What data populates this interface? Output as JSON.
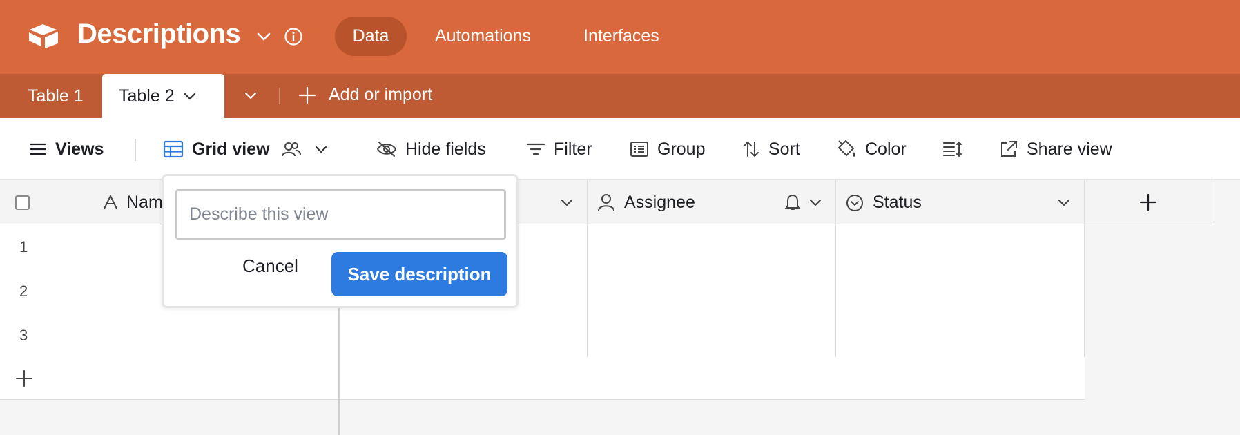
{
  "app": {
    "base_title": "Descriptions",
    "nav": [
      "Data",
      "Automations",
      "Interfaces"
    ],
    "brand_color": "#d9693c"
  },
  "tables": {
    "tabs": [
      "Table 1",
      "Table 2"
    ],
    "active_tab": "Table 2",
    "add_import_label": "Add or import"
  },
  "toolbar": {
    "views_label": "Views",
    "view_name": "Grid view",
    "hide_fields": "Hide fields",
    "filter": "Filter",
    "group": "Group",
    "sort": "Sort",
    "color": "Color",
    "share_view": "Share view"
  },
  "grid": {
    "columns": [
      "Nam",
      "",
      "Assignee",
      "Status"
    ],
    "rows": [
      "1",
      "2",
      "3"
    ]
  },
  "popover": {
    "placeholder": "Describe this view",
    "value": "",
    "cancel_label": "Cancel",
    "save_label": "Save description",
    "save_color": "#2d7be0"
  }
}
